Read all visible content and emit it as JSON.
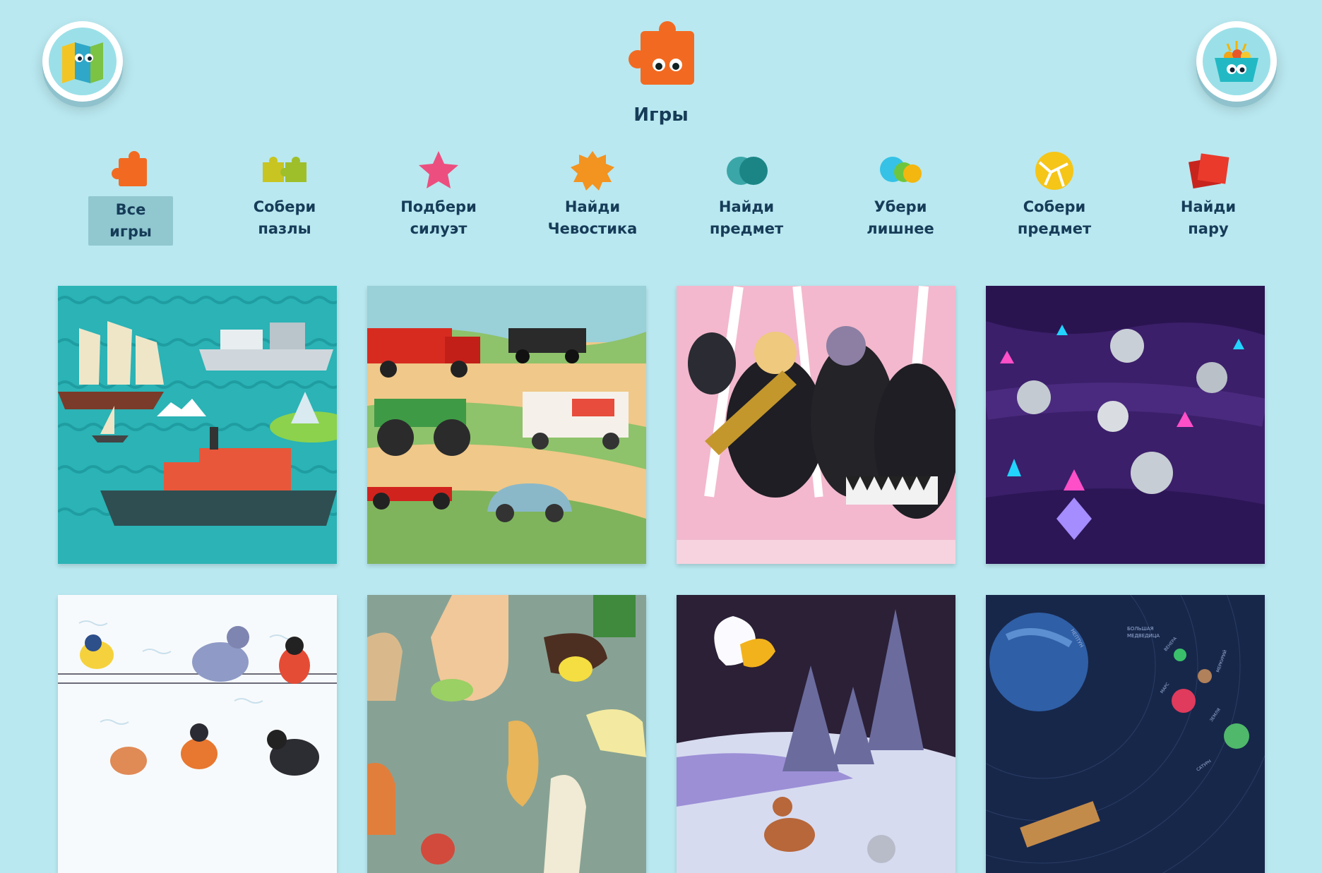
{
  "header": {
    "title": "Игры"
  },
  "corner_buttons": {
    "left_icon": "map-icon",
    "right_icon": "basket-icon"
  },
  "tabs": [
    {
      "line1": "Все",
      "line2": "игры",
      "icon": "puzzle-piece-icon",
      "active": true
    },
    {
      "line1": "Собери",
      "line2": "пазлы",
      "icon": "puzzle-pieces-icon",
      "active": false
    },
    {
      "line1": "Подбери",
      "line2": "силуэт",
      "icon": "star-icon",
      "active": false
    },
    {
      "line1": "Найди",
      "line2": "Чевостика",
      "icon": "spiky-ball-icon",
      "active": false
    },
    {
      "line1": "Найди",
      "line2": "предмет",
      "icon": "circles-icon",
      "active": false
    },
    {
      "line1": "Убери",
      "line2": "лишнее",
      "icon": "three-circles-icon",
      "active": false
    },
    {
      "line1": "Собери",
      "line2": "предмет",
      "icon": "cracked-ball-icon",
      "active": false
    },
    {
      "line1": "Найди",
      "line2": "пару",
      "icon": "cards-icon",
      "active": false
    }
  ],
  "games": [
    {
      "name": "ships-game",
      "theme": "ships"
    },
    {
      "name": "vehicles-game",
      "theme": "vehicles"
    },
    {
      "name": "musicians-game",
      "theme": "musicians"
    },
    {
      "name": "cave-coins-game",
      "theme": "cave"
    },
    {
      "name": "birds-game",
      "theme": "birds"
    },
    {
      "name": "hands-game",
      "theme": "hands"
    },
    {
      "name": "winter-forest-game",
      "theme": "winter-forest"
    },
    {
      "name": "space-game",
      "theme": "space"
    }
  ],
  "space_labels": [
    "НЕПТУН",
    "БОЛЬШАЯ",
    "МЕДВЕДИЦА",
    "ВЕНЕРА",
    "МЕРКУРИЙ",
    "МАРС",
    "ЗЕМЛЯ",
    "САТУРН"
  ]
}
